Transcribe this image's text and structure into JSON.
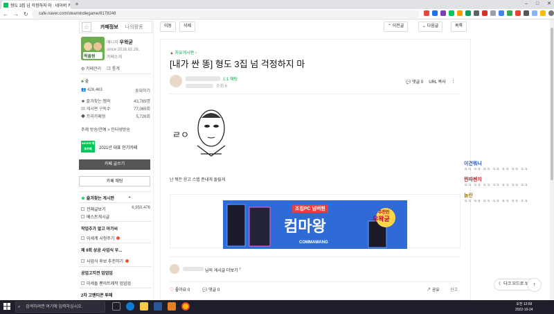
{
  "browser": {
    "tab_title": "형도 3집 넘 걱정하지 마 : 네이버 카페",
    "new_tab": "+",
    "win_controls": [
      "–",
      "□",
      "✕"
    ],
    "nav": [
      "←",
      "→",
      "↻"
    ],
    "url": "cafe.naver.com/steamindiegame/8178248"
  },
  "sidebar": {
    "tab_info": "카페정보",
    "tab_activity": "나의활동",
    "manager_label": "매니저",
    "manager_name": "우왁굳",
    "since": "since 2016.02.26.",
    "cafe_intro": "카페소개",
    "avatar_caption": "왁물원",
    "links": [
      "카페관리",
      "통계"
    ],
    "grade": "숲",
    "member_count": "426,463",
    "invite": "초대하기",
    "stats": [
      {
        "label": "즐겨찾는 멤버",
        "value": "43,789명"
      },
      {
        "label": "게시판 구독수",
        "value": "77,065회"
      },
      {
        "label": "프리카페형",
        "value": "5,726회"
      }
    ],
    "topic": "주제  방송/연예 > 인터넷방송",
    "badge": "NAVER 대표카페",
    "badge_text": "2021년 대표 인기카페",
    "write_btn": "카페 글쓰기",
    "chat_btn": "카페 채팅",
    "fav_board": "즐겨찾는 게시판",
    "all_posts": "전체글보기",
    "all_count": "6,950,476",
    "best": "베스트게시글",
    "sec1": "작업추가 알고 아가씨",
    "sec1_item": "이세계 시청주기",
    "sec2": "제 9회 상공 사업식 우...",
    "sec2_item": "사업식 후보 추천하기",
    "sec3": "공업고지전 업업업",
    "sec3_item": "이세돌 팬아트제작 업업업",
    "sec4": "2차 고멘티콘 투메"
  },
  "toolbar": {
    "move": "이동",
    "delete": "삭제",
    "prev": "이전글",
    "next": "다음글",
    "list": "목록"
  },
  "article": {
    "board": "자유게시판",
    "title": "[내가 싼 똥] 형도 3집 넘 걱정하지 마",
    "author_grade": "1:1 채팅",
    "views": "조회 6",
    "comments_top": "댓글 0",
    "url_copy": "URL 복사",
    "body": "난 뭐든 응고 스텝 준내게 돌릴게",
    "doodle_text": "ㄹㅇ",
    "banner_line1": "조립PC 넘버원",
    "banner_brand": "컴마왕",
    "banner_rec": "추천인",
    "banner_rec_name": "우왁굳",
    "banner_logo": "COMMAWANG",
    "more_posts": "님의 게시글 더보기",
    "like": "좋아요 0",
    "comments": "댓글 0",
    "share": "공유",
    "report": "신고"
  },
  "chat": [
    {
      "name": "이건뭐니",
      "color": "#2a56c6",
      "text": "ㅋㅋ ㅋㅋ ㅋㅋ ㅋㅋ ㅋㅋ ㅋㅋ ㅋㅋ"
    },
    {
      "name": "찐따펜치",
      "color": "#c62a2a",
      "text": "ㅋㅋ ㅋㅋ ㅋㅋ ㅋㅋ ㅋㅋ ㅋㅋ ㅋㅋ"
    },
    {
      "name": "놀란",
      "color": "#b8860b",
      "text": "ㅋㅋ ㅋㅋ ㅋㅋ ㅋㅋ ㅋㅋ ㅋㅋ ㅋㅋ"
    }
  ],
  "dark_mode": "다크 모드로 보기",
  "taskbar": {
    "search": "검색하려면 여기에 입력하십시오.",
    "time": "오전 12:59",
    "date": "2022-10-24"
  }
}
